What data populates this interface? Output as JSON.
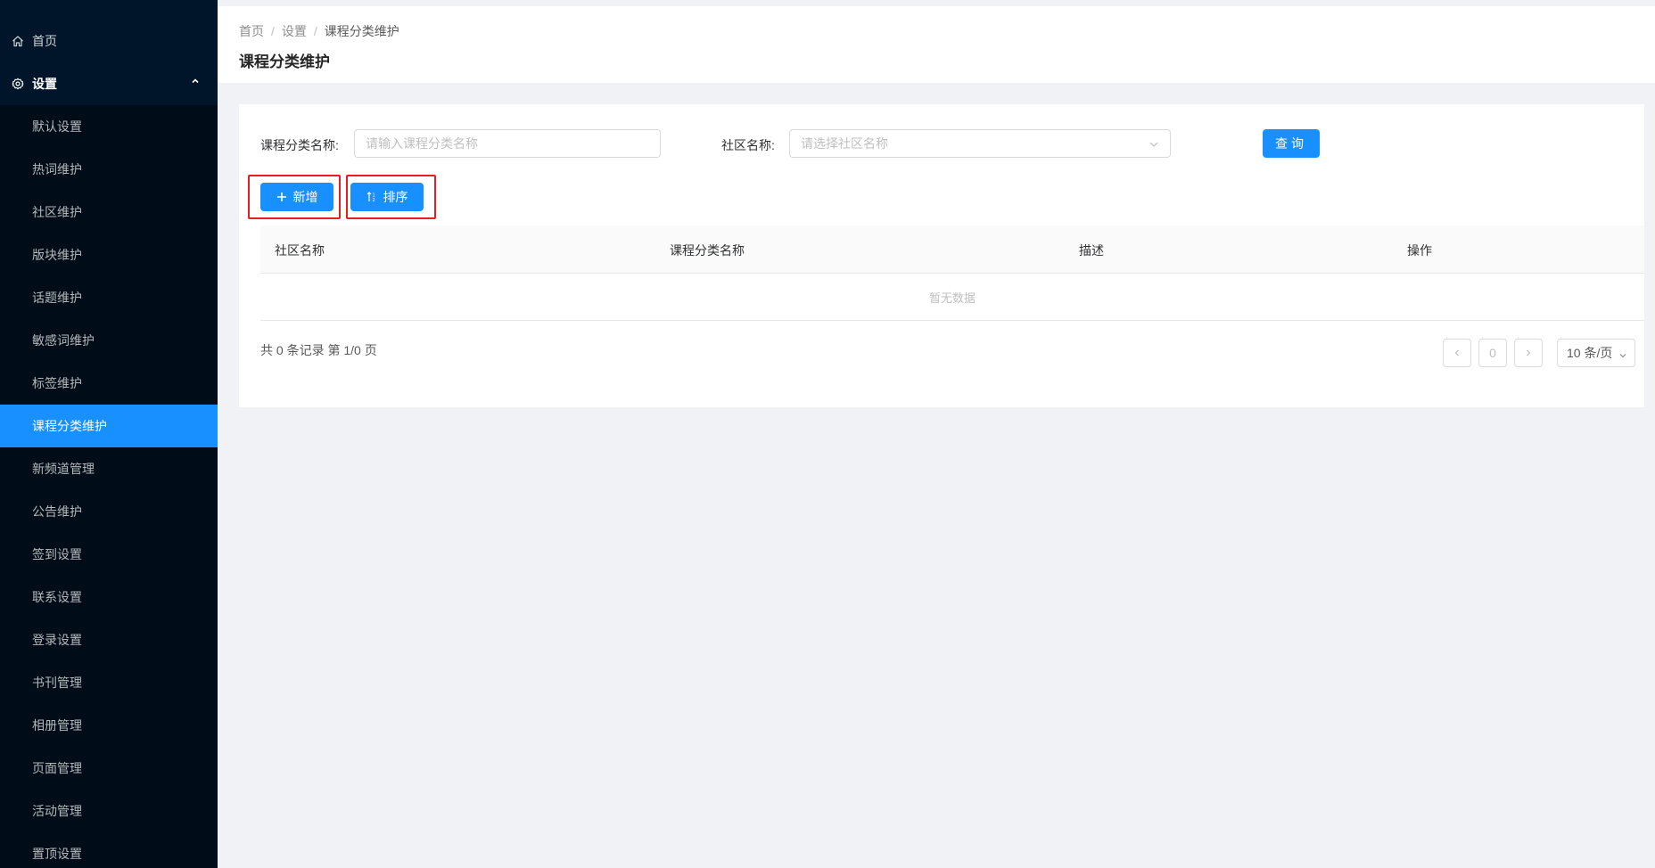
{
  "sidebar": {
    "home_label": "首页",
    "settings_label": "设置",
    "items": [
      {
        "label": "默认设置"
      },
      {
        "label": "热词维护"
      },
      {
        "label": "社区维护"
      },
      {
        "label": "版块维护"
      },
      {
        "label": "话题维护"
      },
      {
        "label": "敏感词维护"
      },
      {
        "label": "标签维护"
      },
      {
        "label": "课程分类维护",
        "active": true
      },
      {
        "label": "新频道管理"
      },
      {
        "label": "公告维护"
      },
      {
        "label": "签到设置"
      },
      {
        "label": "联系设置"
      },
      {
        "label": "登录设置"
      },
      {
        "label": "书刊管理"
      },
      {
        "label": "相册管理"
      },
      {
        "label": "页面管理"
      },
      {
        "label": "活动管理"
      },
      {
        "label": "置顶设置"
      }
    ],
    "colors": {
      "background": "#001529",
      "submenu_background": "#000c17",
      "active": "#1890ff"
    }
  },
  "header": {
    "breadcrumb": [
      "首页",
      "设置",
      "课程分类维护"
    ],
    "breadcrumb_separator": "/",
    "title": "课程分类维护"
  },
  "filters": {
    "category_label": "课程分类名称:",
    "category_placeholder": "请输入课程分类名称",
    "category_value": "",
    "community_label": "社区名称:",
    "community_placeholder": "请选择社区名称",
    "query_label": "查询"
  },
  "actions": {
    "add_label": "新增",
    "sort_label": "排序",
    "highlight_color": "#e81d1d"
  },
  "table": {
    "columns": [
      "社区名称",
      "课程分类名称",
      "描述",
      "操作"
    ],
    "rows": [],
    "empty_text": "暂无数据"
  },
  "pagination": {
    "total_text": "共 0 条记录 第 1/0 页",
    "current_page": "0",
    "page_size": "10 条/页"
  },
  "icons": {
    "home": "home-icon",
    "settings": "gear-icon",
    "caret": "chevron-up-icon",
    "add": "plus-icon",
    "sort": "sort-icon",
    "select": "chevron-down-icon",
    "prev": "chevron-left-icon",
    "next": "chevron-right-icon"
  },
  "theme": {
    "primary": "#1890ff"
  }
}
